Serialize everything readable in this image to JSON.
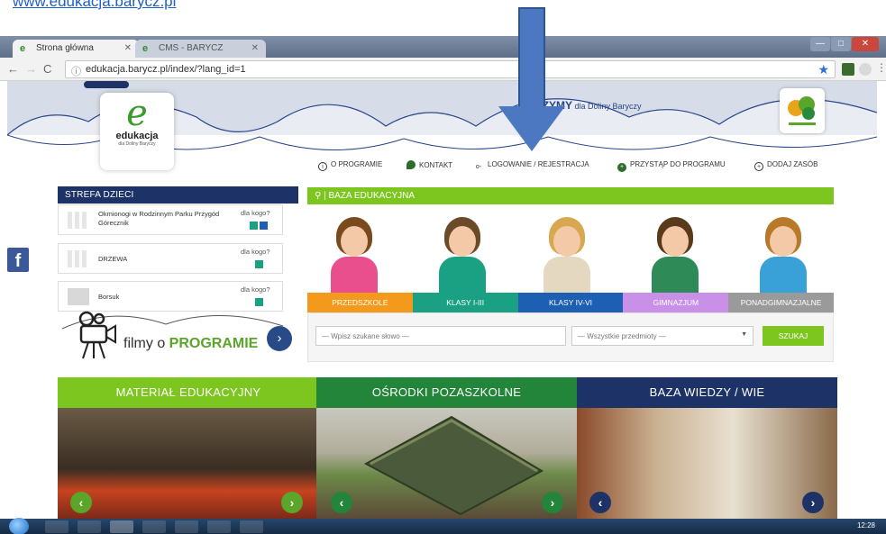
{
  "top_link": "www.edukacja.barycz.pl",
  "browser": {
    "tabs": [
      {
        "label": "Strona główna",
        "active": true
      },
      {
        "label": "CMS - BARYCZ",
        "active": false
      }
    ],
    "url": "edukacja.barycz.pl/index/?lang_id=1",
    "info_icon": "info-icon",
    "star_icon": "bookmark-star-icon"
  },
  "header": {
    "logo_word": "edukacja",
    "logo_sub": "dla Doliny Baryczy",
    "headline_bold": "CZYMY",
    "headline_rest": " dla Doliny Baryczy",
    "menu": [
      {
        "label": "O PROGRAMIE",
        "icon": "info-circle-icon"
      },
      {
        "label": "KONTAKT",
        "icon": "pin-icon"
      },
      {
        "label": "LOGOWANIE / REJESTRACJA",
        "icon": "key-icon"
      },
      {
        "label": "PRZYSTĄP DO PROGRAMU",
        "icon": "plus-circle-icon"
      },
      {
        "label": "DODAJ ZASÓB",
        "icon": "add-circle-icon"
      }
    ]
  },
  "kids_zone": {
    "title": "STREFA DZIECI",
    "items": [
      {
        "title": "Okmionogi w Rodzinnym Parku Przygód Górecznik",
        "who": "dla kogo?"
      },
      {
        "title": "DRZEWA",
        "who": "dla kogo?"
      },
      {
        "title": "Borsuk",
        "who": "dla kogo?"
      }
    ],
    "films_pre": "filmy o ",
    "films_bold": "PROGRAMIE"
  },
  "baza": {
    "title": "BAZA EDUKACYJNA",
    "categories": [
      {
        "label": "PRZEDSZKOLE",
        "color": "#f39a1c"
      },
      {
        "label": "KLASY I-III",
        "color": "#1aa184"
      },
      {
        "label": "KLASY IV-VI",
        "color": "#1d5fb3"
      },
      {
        "label": "GIMNAZJUM",
        "color": "#c990e8"
      },
      {
        "label": "PONADGIMNAZJALNE",
        "color": "#9a9a9a"
      }
    ],
    "search_placeholder": "— Wpisz szukane słowo —",
    "select_value": "— Wszystkie przedmioty —",
    "search_button": "SZUKAJ"
  },
  "bottom": [
    {
      "label": "MATERIAŁ EDUKACYJNY",
      "color": "#7cc61f"
    },
    {
      "label": "OŚRODKI POZASZKOLNE",
      "color": "#22853a"
    },
    {
      "label": "BAZA WIEDZY / WIE",
      "color": "#1d3266"
    }
  ],
  "taskbar": {
    "clock": "12:28"
  }
}
